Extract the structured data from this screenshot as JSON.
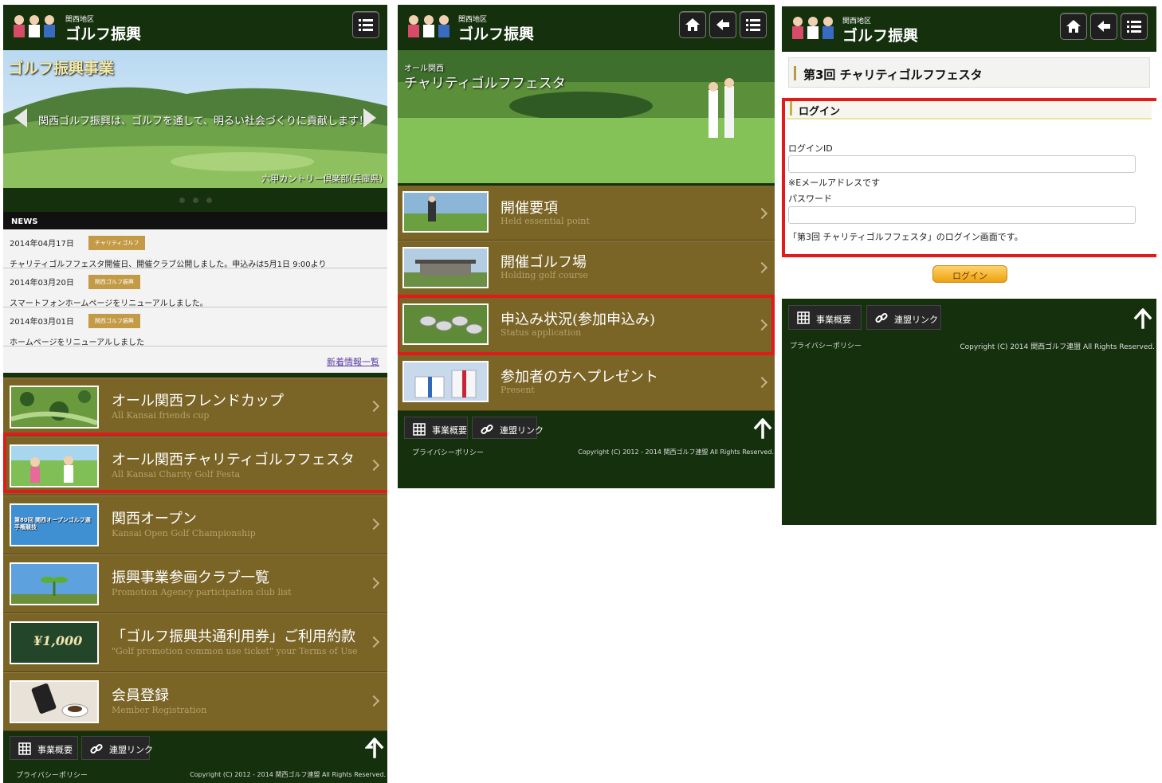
{
  "site": {
    "region_label": "関西地区",
    "brand_name": "ゴルフ振興"
  },
  "screen1": {
    "hero": {
      "title": "ゴルフ振興事業",
      "tagline": "関西ゴルフ振興は、ゴルフを通して、明るい社会づくりに貢献します！",
      "credit": "六甲カントリー倶楽部(兵庫県)"
    },
    "news_label": "NEWS",
    "news": [
      {
        "date": "2014年04月17日",
        "tag": "チャリティゴルフ",
        "text": "チャリティゴルフフェスタ開催日、開催クラブ公開しました。申込みは5月1日 9:00より"
      },
      {
        "date": "2014年03月20日",
        "tag": "関西ゴルフ振興",
        "text": "スマートフォンホームページをリニューアルしました。"
      },
      {
        "date": "2014年03月01日",
        "tag": "関西ゴルフ振興",
        "text": "ホームページをリニューアルしました"
      }
    ],
    "news_more": "新着情報一覧",
    "menu": [
      {
        "title": "オール関西フレンドカップ",
        "sub": "All Kansai friends cup"
      },
      {
        "title": "オール関西チャリティゴルフフェスタ",
        "sub": "All Kansai Charity Golf Festa"
      },
      {
        "title": "関西オープン",
        "sub": "Kansai Open Golf Championship",
        "thumb_text": "第80回 関西オープンゴルフ選手権競技"
      },
      {
        "title": "振興事業参画クラブ一覧",
        "sub": "Promotion Agency participation club list"
      },
      {
        "title": "「ゴルフ振興共通利用券」ご利用約款",
        "sub": "\"Golf promotion common use ticket\" your Terms of Use",
        "thumb_text": "¥1,000"
      },
      {
        "title": "会員登録",
        "sub": "Member Registration"
      }
    ]
  },
  "screen2": {
    "hero": {
      "small": "オール関西",
      "title": "チャリティゴルフフェスタ"
    },
    "menu": [
      {
        "title": "開催要項",
        "sub": "Held essential point"
      },
      {
        "title": "開催ゴルフ場",
        "sub": "Holding golf course"
      },
      {
        "title": "申込み状況(参加申込み)",
        "sub": "Status application"
      },
      {
        "title": "参加者の方へプレゼント",
        "sub": "Present"
      }
    ]
  },
  "screen3": {
    "page_title": "第3回 チャリティゴルフフェスタ",
    "login_heading": "ログイン",
    "login_id_label": "ログインID",
    "login_id_note": "※Eメールアドレスです",
    "password_label": "パスワード",
    "login_desc": "「第3回 チャリティゴルフフェスタ」のログイン画面です。",
    "login_button": "ログイン",
    "copyright": "Copyright (C) 2014 関西ゴルフ連盟 All Rights Reserved."
  },
  "footer": {
    "about_label": "事業概要",
    "links_label": "連盟リンク",
    "privacy_label": "プライバシーポリシー",
    "copyright": "Copyright (C) 2012 - 2014 関西ゴルフ連盟 All Rights Reserved."
  },
  "icons": {
    "home": "home-icon",
    "back": "back-arrow-icon",
    "menu": "menu-list-icon",
    "grid": "grid-icon",
    "link": "link-icon",
    "up": "up-arrow-icon"
  },
  "colors": {
    "header_bg": "#14300d",
    "menu_bg": "#7a6426",
    "tag_bg": "#c39a45",
    "highlight_border": "#e21a1a",
    "login_button": "#eea10f"
  }
}
